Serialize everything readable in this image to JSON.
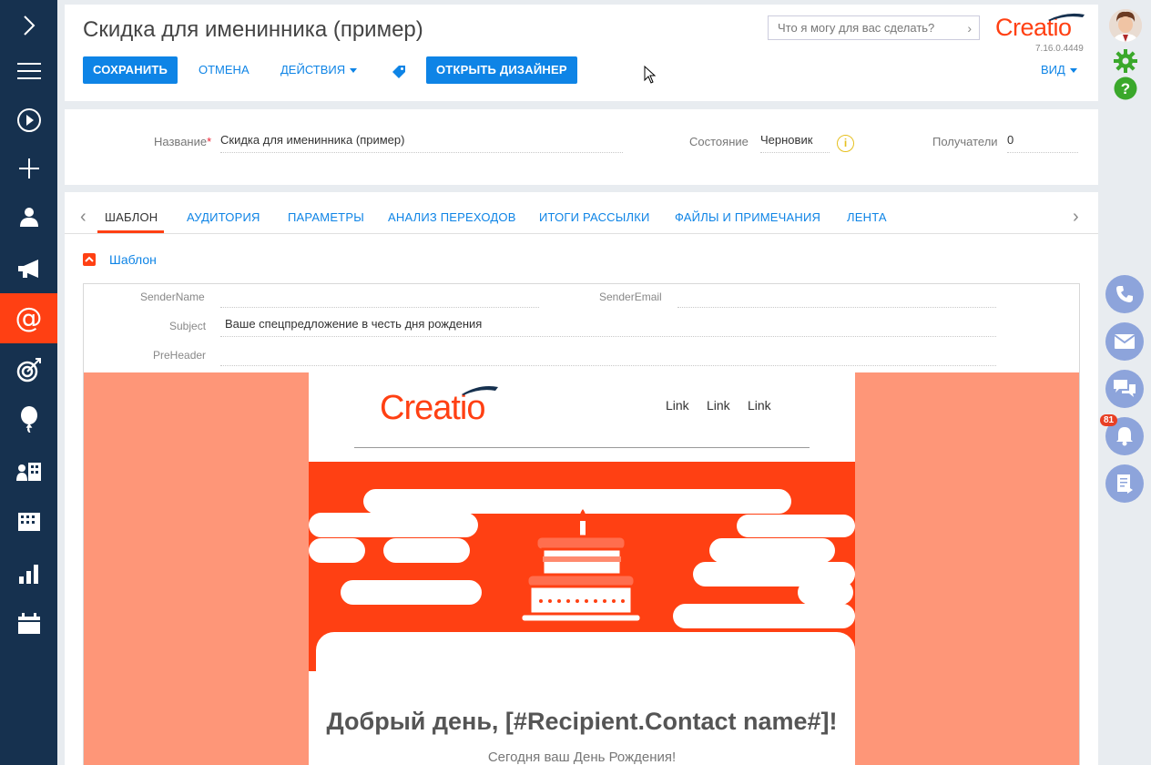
{
  "nav": {
    "items": [
      "menu-expand",
      "hamburger",
      "process",
      "add",
      "contacts",
      "campaigns",
      "email",
      "goals",
      "events",
      "accounts",
      "buildings",
      "analytics",
      "calendar"
    ],
    "active": "email"
  },
  "header": {
    "title": "Скидка для именинника (пример)",
    "save": "СОХРАНИТЬ",
    "cancel": "ОТМЕНА",
    "actions": "ДЕЙСТВИЯ",
    "open_designer": "ОТКРЫТЬ ДИЗАЙНЕР",
    "view": "ВИД",
    "search_placeholder": "Что я могу для вас сделать?",
    "logo": "Creatio",
    "version": "7.16.0.4449"
  },
  "fields": {
    "name_label": "Название",
    "name_value": "Скидка для именинника (пример)",
    "state_label": "Состояние",
    "state_value": "Черновик",
    "recipients_label": "Получатели",
    "recipients_value": "0"
  },
  "tabs": [
    "ШАБЛОН",
    "АУДИТОРИЯ",
    "ПАРАМЕТРЫ",
    "АНАЛИЗ ПЕРЕХОДОВ",
    "ИТОГИ РАССЫЛКИ",
    "ФАЙЛЫ И ПРИМЕЧАНИЯ",
    "ЛЕНТА"
  ],
  "section": {
    "title": "Шаблон",
    "sender_name_label": "SenderName",
    "sender_name_value": "",
    "sender_email_label": "SenderEmail",
    "sender_email_value": "",
    "subject_label": "Subject",
    "subject_value": "Ваше спецпредложение в честь дня рождения",
    "preheader_label": "PreHeader",
    "preheader_value": ""
  },
  "email": {
    "logo": "Creatio",
    "links": [
      "Link",
      "Link",
      "Link"
    ],
    "greeting": "Добрый день, [#Recipient.Contact name#]!",
    "subtitle": "Сегодня ваш День Рождения!"
  },
  "rail": {
    "notifications_count": "81",
    "buttons": [
      "phone-icon",
      "mail-icon",
      "chat-icon",
      "bell-icon",
      "feed-icon"
    ]
  },
  "colors": {
    "nav_bg": "#16314f",
    "accent": "#ff4013",
    "primary": "#0e84e6",
    "email_bg": "#fe9678",
    "rail_btn": "#8da4db"
  }
}
